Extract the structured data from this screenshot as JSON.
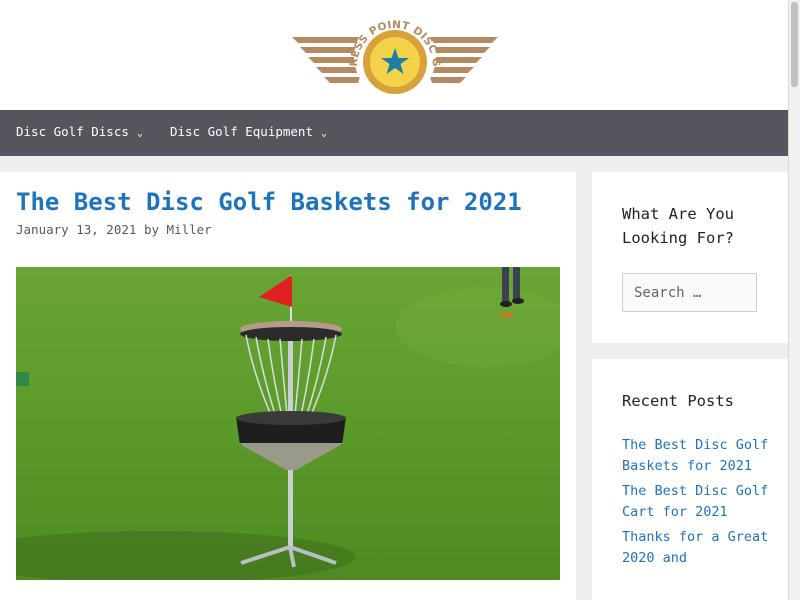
{
  "site": {
    "logo_text": "CYPRESS POINT DISC GOLF",
    "logo_colors": {
      "wing": "#b68a60",
      "badge_outer": "#d8a13a",
      "badge_inner": "#f4d24a",
      "star": "#1f7ea6"
    }
  },
  "nav": {
    "items": [
      {
        "label": "Disc Golf Discs",
        "icon": "chevron-down-icon"
      },
      {
        "label": "Disc Golf Equipment",
        "icon": "chevron-down-icon"
      }
    ]
  },
  "post": {
    "title": "The Best Disc Golf Baskets for 2021",
    "date": "January 13, 2021",
    "by": "by",
    "author": "Miller"
  },
  "sidebar": {
    "search_title": "What Are You Looking For?",
    "search_placeholder": "Search …",
    "recent_title": "Recent Posts",
    "recent_posts": [
      "The Best Disc Golf Baskets for 2021",
      "The Best Disc Golf Cart for 2021",
      "Thanks for a Great 2020 and"
    ]
  },
  "colors": {
    "link": "#1e73be",
    "nav_bg": "#55555e",
    "page_bg": "#efefef"
  }
}
